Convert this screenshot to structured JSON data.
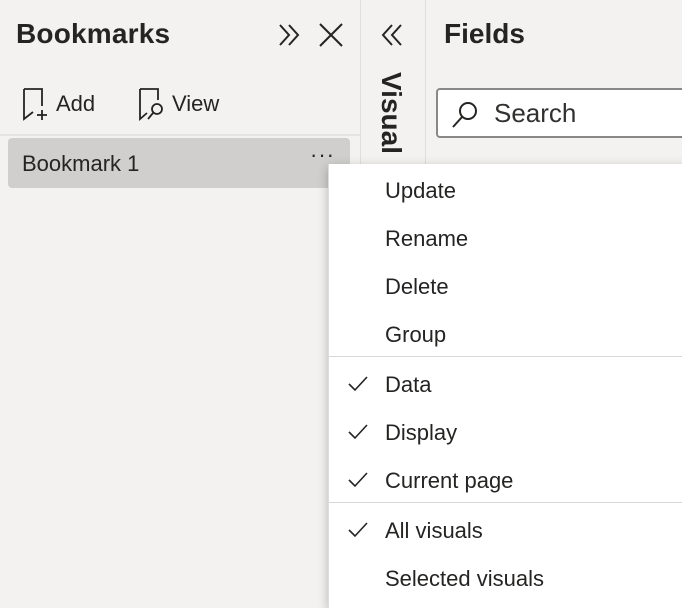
{
  "bookmarks": {
    "title": "Bookmarks",
    "add_label": "Add",
    "view_label": "View",
    "items": [
      {
        "label": "Bookmark 1",
        "more": "···"
      }
    ]
  },
  "visualizations": {
    "label": "Visual"
  },
  "fields": {
    "title": "Fields",
    "search_placeholder": "Search"
  },
  "context_menu": {
    "actions": [
      {
        "label": "Update"
      },
      {
        "label": "Rename"
      },
      {
        "label": "Delete"
      },
      {
        "label": "Group"
      }
    ],
    "capture_options": [
      {
        "label": "Data",
        "checked": true
      },
      {
        "label": "Display",
        "checked": true
      },
      {
        "label": "Current page",
        "checked": true
      }
    ],
    "scope_options": [
      {
        "label": "All visuals",
        "checked": true
      },
      {
        "label": "Selected visuals",
        "checked": false
      }
    ]
  },
  "icons": {
    "expand": "chevron-double-right-icon",
    "close": "close-icon",
    "add_bookmark": "bookmark-add-icon",
    "view_bookmark": "bookmark-view-icon",
    "collapse": "chevron-double-left-icon",
    "search": "search-icon",
    "check": "checkmark-icon"
  }
}
